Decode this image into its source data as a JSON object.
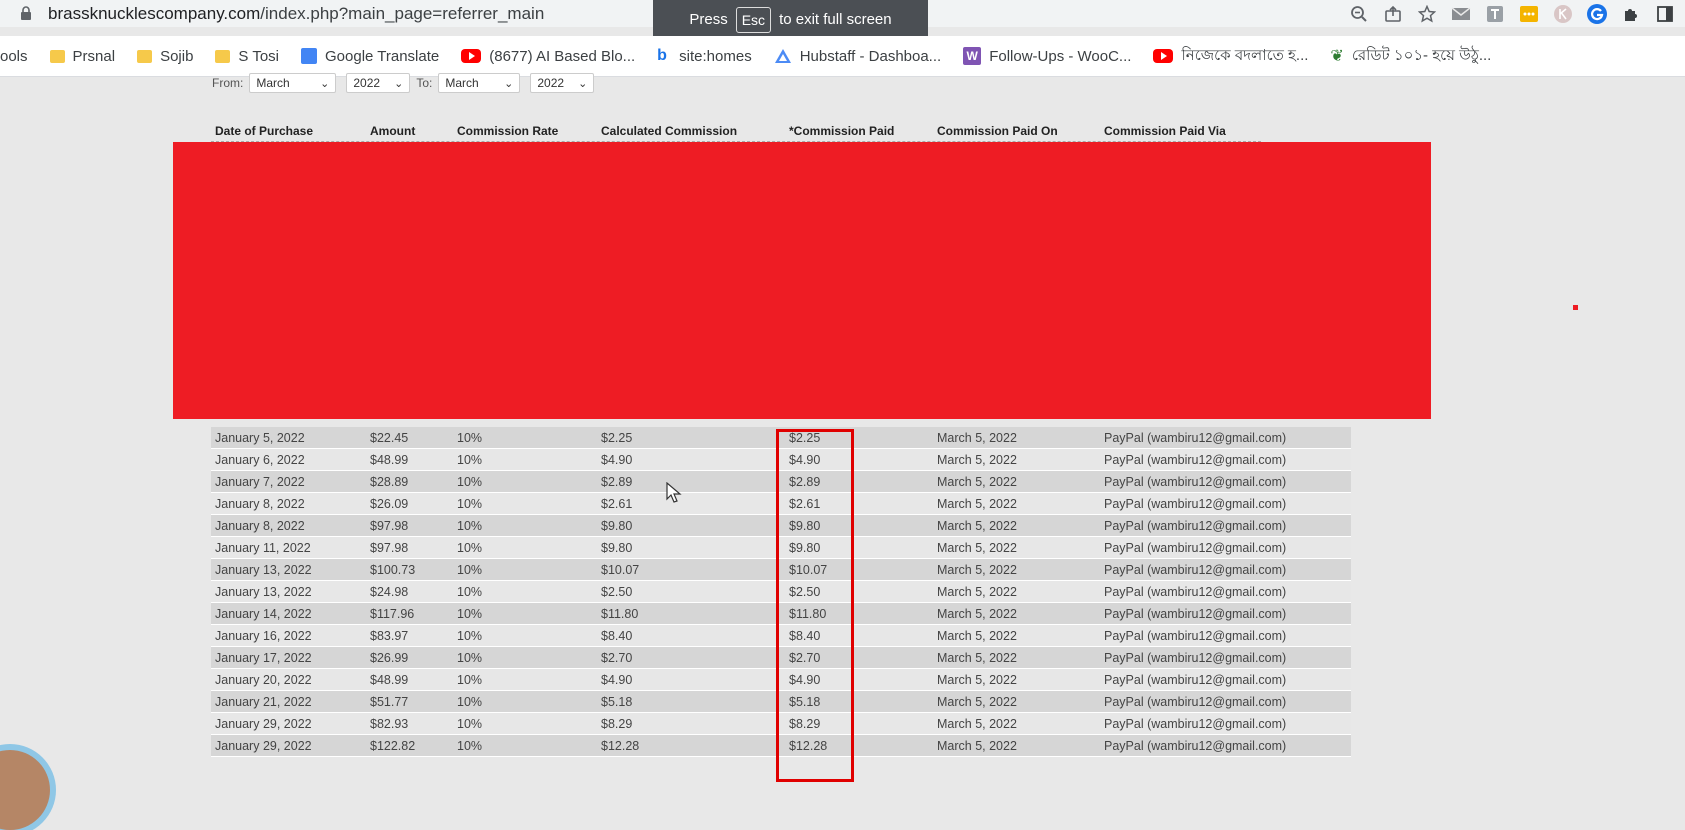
{
  "browser": {
    "url_host": "brassknucklescompany.com",
    "url_path": "/index.php?main_page=referrer_main",
    "toast": {
      "press": "Press",
      "key": "Esc",
      "suffix": "to exit full screen"
    },
    "bookmarks": [
      {
        "label": "ools",
        "icon": "none"
      },
      {
        "label": "Prsnal",
        "icon": "folder-icon"
      },
      {
        "label": "Sojib",
        "icon": "folder-icon"
      },
      {
        "label": "S Tosi",
        "icon": "folder-icon"
      },
      {
        "label": "Google Translate",
        "icon": "translate-icon"
      },
      {
        "label": "(8677) AI Based Blo...",
        "icon": "youtube-icon"
      },
      {
        "label": "site:homes",
        "icon": "bing-icon"
      },
      {
        "label": "Hubstaff - Dashboa...",
        "icon": "hubstaff-icon"
      },
      {
        "label": "Follow-Ups - WooC...",
        "icon": "woo-icon"
      },
      {
        "label": "নিজেকে বদলাতে হ...",
        "icon": "youtube-icon"
      },
      {
        "label": "রেডিট ১০১- হয়ে উঠু...",
        "icon": "green-icon"
      }
    ]
  },
  "filters": {
    "from_label": "From:",
    "from_month": "March",
    "from_year": "2022",
    "to_label": "To:",
    "to_month": "March",
    "to_year": "2022"
  },
  "table": {
    "headers": [
      "Date of Purchase",
      "Amount",
      "Commission Rate",
      "Calculated Commission",
      "*Commission Paid",
      "Commission Paid On",
      "Commission Paid Via"
    ],
    "rows": [
      [
        "January 5, 2022",
        "$22.45",
        "10%",
        "$2.25",
        "$2.25",
        "March 5, 2022",
        "PayPal (wambiru12@gmail.com)"
      ],
      [
        "January 6, 2022",
        "$48.99",
        "10%",
        "$4.90",
        "$4.90",
        "March 5, 2022",
        "PayPal (wambiru12@gmail.com)"
      ],
      [
        "January 7, 2022",
        "$28.89",
        "10%",
        "$2.89",
        "$2.89",
        "March 5, 2022",
        "PayPal (wambiru12@gmail.com)"
      ],
      [
        "January 8, 2022",
        "$26.09",
        "10%",
        "$2.61",
        "$2.61",
        "March 5, 2022",
        "PayPal (wambiru12@gmail.com)"
      ],
      [
        "January 8, 2022",
        "$97.98",
        "10%",
        "$9.80",
        "$9.80",
        "March 5, 2022",
        "PayPal (wambiru12@gmail.com)"
      ],
      [
        "January 11, 2022",
        "$97.98",
        "10%",
        "$9.80",
        "$9.80",
        "March 5, 2022",
        "PayPal (wambiru12@gmail.com)"
      ],
      [
        "January 13, 2022",
        "$100.73",
        "10%",
        "$10.07",
        "$10.07",
        "March 5, 2022",
        "PayPal (wambiru12@gmail.com)"
      ],
      [
        "January 13, 2022",
        "$24.98",
        "10%",
        "$2.50",
        "$2.50",
        "March 5, 2022",
        "PayPal (wambiru12@gmail.com)"
      ],
      [
        "January 14, 2022",
        "$117.96",
        "10%",
        "$11.80",
        "$11.80",
        "March 5, 2022",
        "PayPal (wambiru12@gmail.com)"
      ],
      [
        "January 16, 2022",
        "$83.97",
        "10%",
        "$8.40",
        "$8.40",
        "March 5, 2022",
        "PayPal (wambiru12@gmail.com)"
      ],
      [
        "January 17, 2022",
        "$26.99",
        "10%",
        "$2.70",
        "$2.70",
        "March 5, 2022",
        "PayPal (wambiru12@gmail.com)"
      ],
      [
        "January 20, 2022",
        "$48.99",
        "10%",
        "$4.90",
        "$4.90",
        "March 5, 2022",
        "PayPal (wambiru12@gmail.com)"
      ],
      [
        "January 21, 2022",
        "$51.77",
        "10%",
        "$5.18",
        "$5.18",
        "March 5, 2022",
        "PayPal (wambiru12@gmail.com)"
      ],
      [
        "January 29, 2022",
        "$82.93",
        "10%",
        "$8.29",
        "$8.29",
        "March 5, 2022",
        "PayPal (wambiru12@gmail.com)"
      ],
      [
        "January 29, 2022",
        "$122.82",
        "10%",
        "$12.28",
        "$12.28",
        "March 5, 2022",
        "PayPal (wambiru12@gmail.com)"
      ]
    ]
  },
  "colors": {
    "redaction": "#ee1c24",
    "highlight": "#e00000"
  }
}
